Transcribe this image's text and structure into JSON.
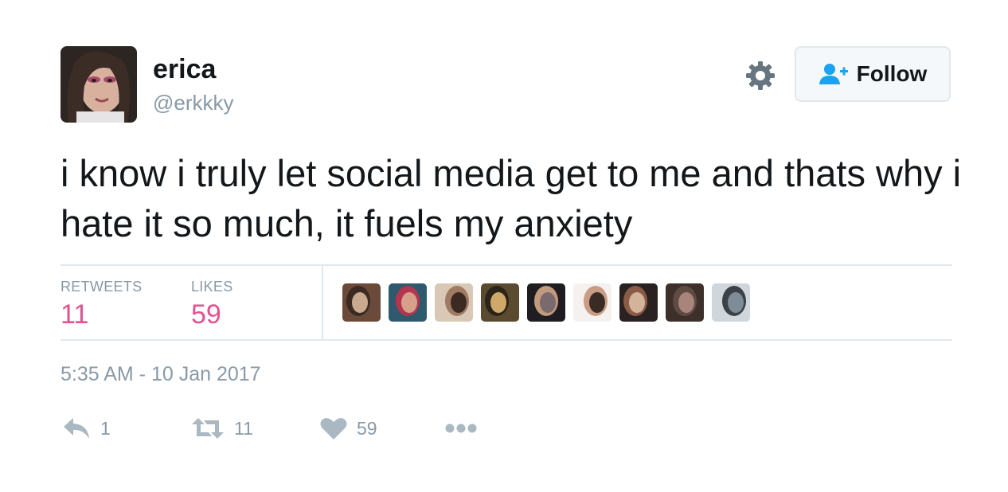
{
  "user": {
    "display_name": "erica",
    "handle": "@erkkky",
    "avatar_icon": "profile-photo"
  },
  "header": {
    "settings_icon": "gear-icon",
    "follow_label": "Follow",
    "follow_icon": "add-user-icon"
  },
  "tweet": {
    "text": "i know i truly let social media get to me and thats why i hate it so much, it fuels my anxiety",
    "timestamp": "5:35 AM - 10 Jan 2017"
  },
  "stats": {
    "retweets_label": "RETWEETS",
    "retweets_value": "11",
    "likes_label": "LIKES",
    "likes_value": "59"
  },
  "liker_avatars": [
    {
      "icon": "liker-avatar-1",
      "palette": [
        "#6b4a3a",
        "#c9a98f",
        "#3a2a22"
      ]
    },
    {
      "icon": "liker-avatar-2",
      "palette": [
        "#2f5a6e",
        "#d6a08a",
        "#b2364f"
      ]
    },
    {
      "icon": "liker-avatar-3",
      "palette": [
        "#d9c8b6",
        "#3b2a22",
        "#a07a62"
      ]
    },
    {
      "icon": "liker-avatar-4",
      "palette": [
        "#5a4a30",
        "#cfa86a",
        "#2b2419"
      ]
    },
    {
      "icon": "liker-avatar-5",
      "palette": [
        "#1f1d22",
        "#7a6a6e",
        "#c29a7c"
      ]
    },
    {
      "icon": "liker-avatar-6",
      "palette": [
        "#f4f1ee",
        "#3a2b25",
        "#c99c86"
      ]
    },
    {
      "icon": "liker-avatar-7",
      "palette": [
        "#2a2220",
        "#d4b39c",
        "#8a5c47"
      ]
    },
    {
      "icon": "liker-avatar-8",
      "palette": [
        "#3d302b",
        "#a8847a",
        "#5e4b42"
      ]
    },
    {
      "icon": "liker-avatar-9",
      "palette": [
        "#cfd6dc",
        "#7d8c96",
        "#3b4147"
      ]
    }
  ],
  "actions": {
    "reply_icon": "reply-icon",
    "reply_count": "1",
    "retweet_icon": "retweet-icon",
    "retweet_count": "11",
    "like_icon": "heart-icon",
    "like_count": "59",
    "more_icon": "more-dots-icon"
  },
  "colors": {
    "accent_blue": "#1da1f2",
    "stat_pink": "#e0538f",
    "muted_gray": "#8899a6",
    "action_gray": "#aab8c2",
    "divider": "#e1e8ed"
  }
}
